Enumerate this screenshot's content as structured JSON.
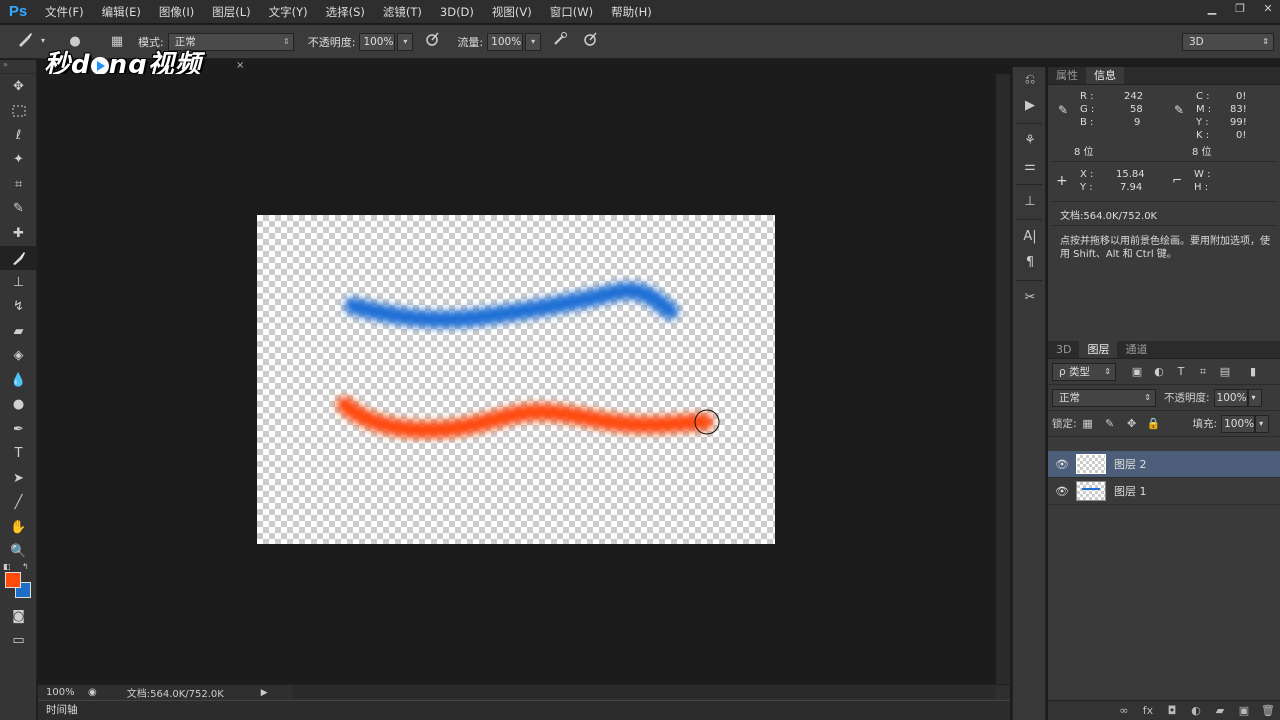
{
  "app": {
    "logo": "Ps"
  },
  "menu": [
    "文件(F)",
    "编辑(E)",
    "图像(I)",
    "图层(L)",
    "文字(Y)",
    "选择(S)",
    "滤镜(T)",
    "3D(D)",
    "视图(V)",
    "窗口(W)",
    "帮助(H)"
  ],
  "window_controls": {
    "minimize": "▁",
    "restore": "❐",
    "close": "✕"
  },
  "options": {
    "mode_label": "模式:",
    "mode_value": "正常",
    "opacity_label": "不透明度:",
    "opacity_value": "100%",
    "flow_label": "流量:",
    "flow_value": "100%"
  },
  "workspace": {
    "value": "3D"
  },
  "watermark": {
    "text_left": "秒d",
    "text_right": "ng视频"
  },
  "document_tab": {
    "close": "×"
  },
  "canvas": {
    "strokes": [
      {
        "name": "blue stroke",
        "color": "#1e6ed6"
      },
      {
        "name": "orange stroke",
        "color": "#ff4a10"
      }
    ]
  },
  "colors": {
    "foreground": "#ff4b0a",
    "background": "#1e6ec8"
  },
  "status": {
    "zoom": "100%",
    "doc_info": "文档:564.0K/752.0K",
    "arrow": "▶"
  },
  "timeline": {
    "label": "时间轴"
  },
  "info_panel": {
    "tabs": [
      "属性",
      "信息"
    ],
    "rgb": {
      "R": "242",
      "G": "58",
      "B": "9"
    },
    "cmyk": {
      "C": "0!",
      "M": "83!",
      "Y": "99!",
      "K": "0!"
    },
    "bit_left": "8 位",
    "bit_right": "8 位",
    "xy": {
      "X": "15.84",
      "Y": "7.94"
    },
    "wh": {
      "W": "",
      "H": ""
    },
    "doc": "文档:564.0K/752.0K",
    "hint": "点按并拖移以用前景色绘画。要用附加选项，使用 Shift、Alt 和 Ctrl 键。"
  },
  "layers_panel": {
    "tabs": [
      "3D",
      "图层",
      "通道"
    ],
    "filter_label": "ρ 类型",
    "blend_mode": "正常",
    "opacity_label": "不透明度:",
    "opacity_value": "100%",
    "lock_label": "锁定:",
    "fill_label": "填充:",
    "fill_value": "100%",
    "layers": [
      {
        "name": "图层 2",
        "selected": true
      },
      {
        "name": "图层 1",
        "selected": false
      }
    ]
  }
}
